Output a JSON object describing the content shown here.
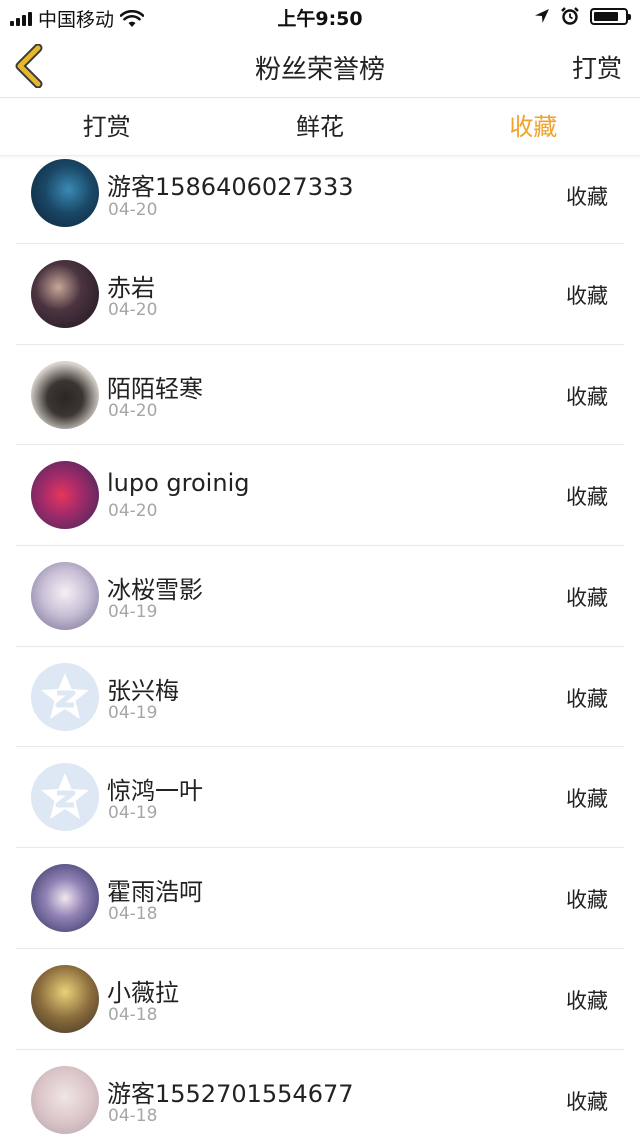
{
  "status_bar": {
    "carrier": "中国移动",
    "time": "上午9:50",
    "battery_level": 0.8
  },
  "header": {
    "title": "粉丝荣誉榜",
    "back_icon": "chevron-left-icon",
    "action_label": "打赏"
  },
  "tabs": [
    {
      "label": "打赏",
      "active": false
    },
    {
      "label": "鲜花",
      "active": false
    },
    {
      "label": "收藏",
      "active": true
    }
  ],
  "colors": {
    "accent": "#f0a22a",
    "back_icon": "#e8b82b",
    "text": "#222222",
    "date": "#a6a6a6",
    "divider": "#e8e8e8"
  },
  "fans": [
    {
      "name": "游客1586406027333",
      "date": "04-20",
      "action": "收藏",
      "avatar": "photo-avatar"
    },
    {
      "name": "赤岩",
      "date": "04-20",
      "action": "收藏",
      "avatar": "photo-avatar"
    },
    {
      "name": "陌陌轻寒",
      "date": "04-20",
      "action": "收藏",
      "avatar": "cat-photo-avatar"
    },
    {
      "name": "lupo groinig",
      "date": "04-20",
      "action": "收藏",
      "avatar": "photo-avatar"
    },
    {
      "name": "冰桜雪影",
      "date": "04-19",
      "action": "收藏",
      "avatar": "anime-avatar"
    },
    {
      "name": "张兴梅",
      "date": "04-19",
      "action": "收藏",
      "avatar": "default-qq-avatar"
    },
    {
      "name": "惊鸿一叶",
      "date": "04-19",
      "action": "收藏",
      "avatar": "default-qq-avatar"
    },
    {
      "name": "霍雨浩呵",
      "date": "04-18",
      "action": "收藏",
      "avatar": "anime-avatar"
    },
    {
      "name": "小薇拉",
      "date": "04-18",
      "action": "收藏",
      "avatar": "anime-avatar"
    },
    {
      "name": "游客1552701554677",
      "date": "04-18",
      "action": "收藏",
      "avatar": "photo-avatar"
    }
  ]
}
